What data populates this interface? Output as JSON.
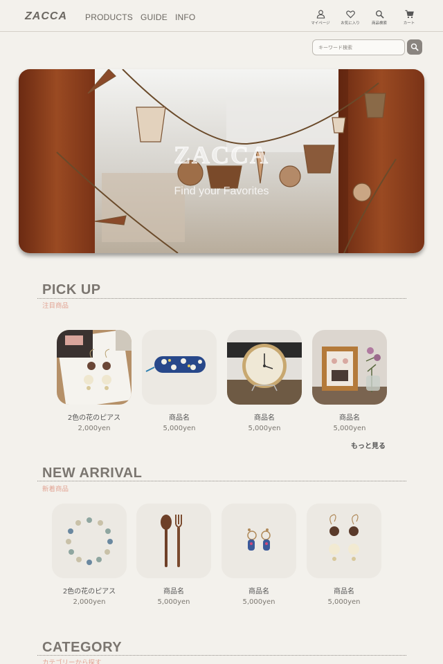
{
  "header": {
    "logo": "ZACCA",
    "nav": [
      "PRODUCTS",
      "GUIDE",
      "INFO"
    ],
    "icons": [
      {
        "icon": "user-icon",
        "label": "マイページ"
      },
      {
        "icon": "heart-icon",
        "label": "お気に入り"
      },
      {
        "icon": "search-icon",
        "label": "商品検索"
      },
      {
        "icon": "cart-icon",
        "label": "カート"
      }
    ]
  },
  "search": {
    "placeholder": "キーワード検索"
  },
  "hero": {
    "title": "ZACCA",
    "subtitle": "Find your Favorites"
  },
  "pickup": {
    "title": "PICK UP",
    "subtitle": "注目商品",
    "more": "もっと見る",
    "items": [
      {
        "name": "2色の花のピアス",
        "price": "2,000yen"
      },
      {
        "name": "商品名",
        "price": "5,000yen"
      },
      {
        "name": "商品名",
        "price": "5,000yen"
      },
      {
        "name": "商品名",
        "price": "5,000yen"
      }
    ]
  },
  "new_arrival": {
    "title": "NEW ARRIVAL",
    "subtitle": "新着商品",
    "items": [
      {
        "name": "2色の花のピアス",
        "price": "2,000yen"
      },
      {
        "name": "商品名",
        "price": "5,000yen"
      },
      {
        "name": "商品名",
        "price": "5,000yen"
      },
      {
        "name": "商品名",
        "price": "5,000yen"
      }
    ]
  },
  "category": {
    "title": "CATEGORY",
    "subtitle": "カテゴリーから探す"
  },
  "colors": {
    "background": "#f3f1ec",
    "accent": "#e2a494",
    "heading": "#7b7670"
  }
}
